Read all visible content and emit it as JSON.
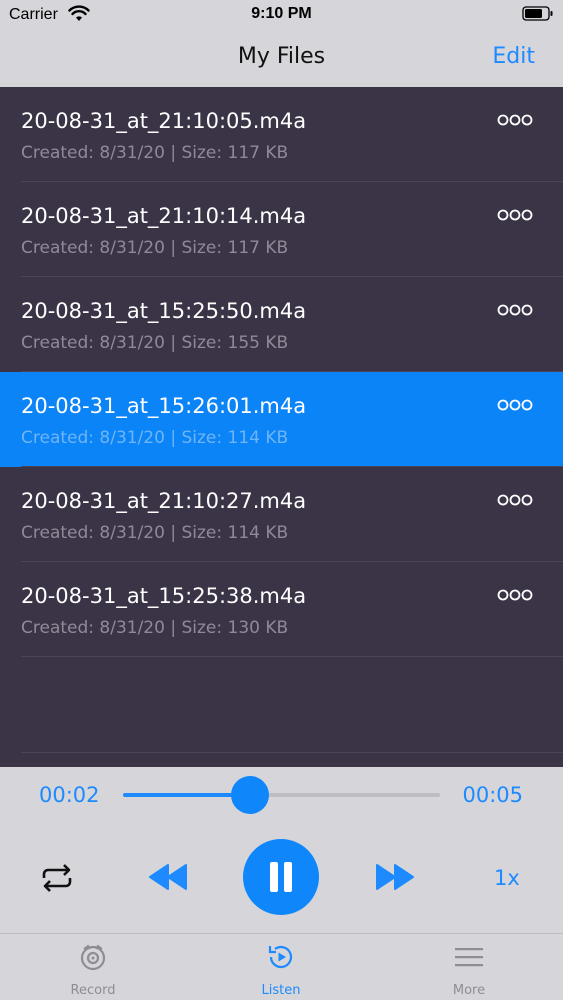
{
  "status_bar": {
    "carrier": "Carrier",
    "time": "9:10 PM"
  },
  "nav": {
    "title": "My Files",
    "edit_label": "Edit"
  },
  "files": [
    {
      "name": "20-08-31_at_21:10:05.m4a",
      "meta": "Created: 8/31/20 | Size: 117 KB",
      "selected": false
    },
    {
      "name": "20-08-31_at_21:10:14.m4a",
      "meta": "Created: 8/31/20 | Size: 117 KB",
      "selected": false
    },
    {
      "name": "20-08-31_at_15:25:50.m4a",
      "meta": "Created: 8/31/20 | Size: 155 KB",
      "selected": false
    },
    {
      "name": "20-08-31_at_15:26:01.m4a",
      "meta": "Created: 8/31/20 | Size: 114 KB",
      "selected": true
    },
    {
      "name": "20-08-31_at_21:10:27.m4a",
      "meta": "Created: 8/31/20 | Size: 114 KB",
      "selected": false
    },
    {
      "name": "20-08-31_at_15:25:38.m4a",
      "meta": "Created: 8/31/20 | Size: 130 KB",
      "selected": false
    }
  ],
  "player": {
    "current_time": "00:02",
    "total_time": "00:05",
    "progress": 0.4,
    "speed_label": "1x",
    "state": "playing"
  },
  "tabs": [
    {
      "label": "Record",
      "icon": "record-icon",
      "active": false
    },
    {
      "label": "Listen",
      "icon": "listen-icon",
      "active": true
    },
    {
      "label": "More",
      "icon": "menu-icon",
      "active": false
    }
  ],
  "colors": {
    "accent": "#1d8bff",
    "list_background": "#3b3446",
    "selected_row": "#0b84f8",
    "bar_background": "#d5d5da"
  }
}
